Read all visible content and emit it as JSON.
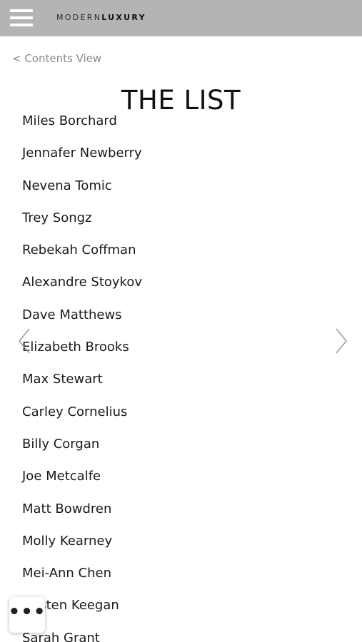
{
  "header": {
    "menu_icon": "hamburger-menu-icon",
    "brand_part1": "MODERN",
    "brand_part2": "LUXURY",
    "background": "#b4b4b4"
  },
  "navigation": {
    "back_label": "< Contents View",
    "prev_icon": "chevron-left-icon",
    "next_icon": "chevron-right-icon"
  },
  "page": {
    "title": "THE LIST"
  },
  "list": {
    "items": [
      "Miles Borchard",
      "Jennafer Newberry",
      "Nevena Tomic",
      "Trey Songz",
      "Rebekah Coffman",
      "Alexandre Stoykov",
      "Dave Matthews",
      "Elizabeth Brooks",
      "Max Stewart",
      "Carley Cornelius",
      "Billy Corgan",
      "Joe Metcalfe",
      "Matt Bowdren",
      "Molly Kearney",
      "Mei-Ann Chen",
      "Kristen Keegan",
      "Sarah Grant"
    ]
  },
  "floating": {
    "more_icon": "more-dots-icon",
    "more_label": "•••"
  }
}
